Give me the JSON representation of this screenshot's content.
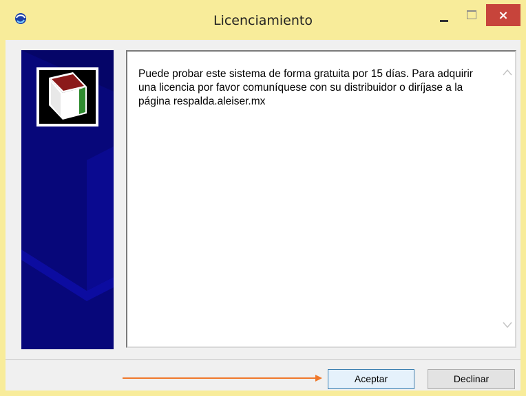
{
  "window": {
    "title": "Licenciamiento",
    "close_label": "×"
  },
  "message": {
    "text": "Puede probar este sistema de forma gratuita por 15 días. Para adquirir una licencia por favor comuníquese con su distribuidor o diríjase a la página respalda.aleiser.mx"
  },
  "buttons": {
    "accept": "Aceptar",
    "decline": "Declinar"
  },
  "icons": {
    "app": "app-globe-icon",
    "logo": "box-logo-icon",
    "scroll_up": "chevron-up-icon",
    "scroll_down": "chevron-down-icon"
  },
  "colors": {
    "title_bg": "#f8ec9a",
    "close_bg": "#c7443b",
    "banner_bg": "#050568",
    "annotation_arrow": "#f0782a"
  }
}
